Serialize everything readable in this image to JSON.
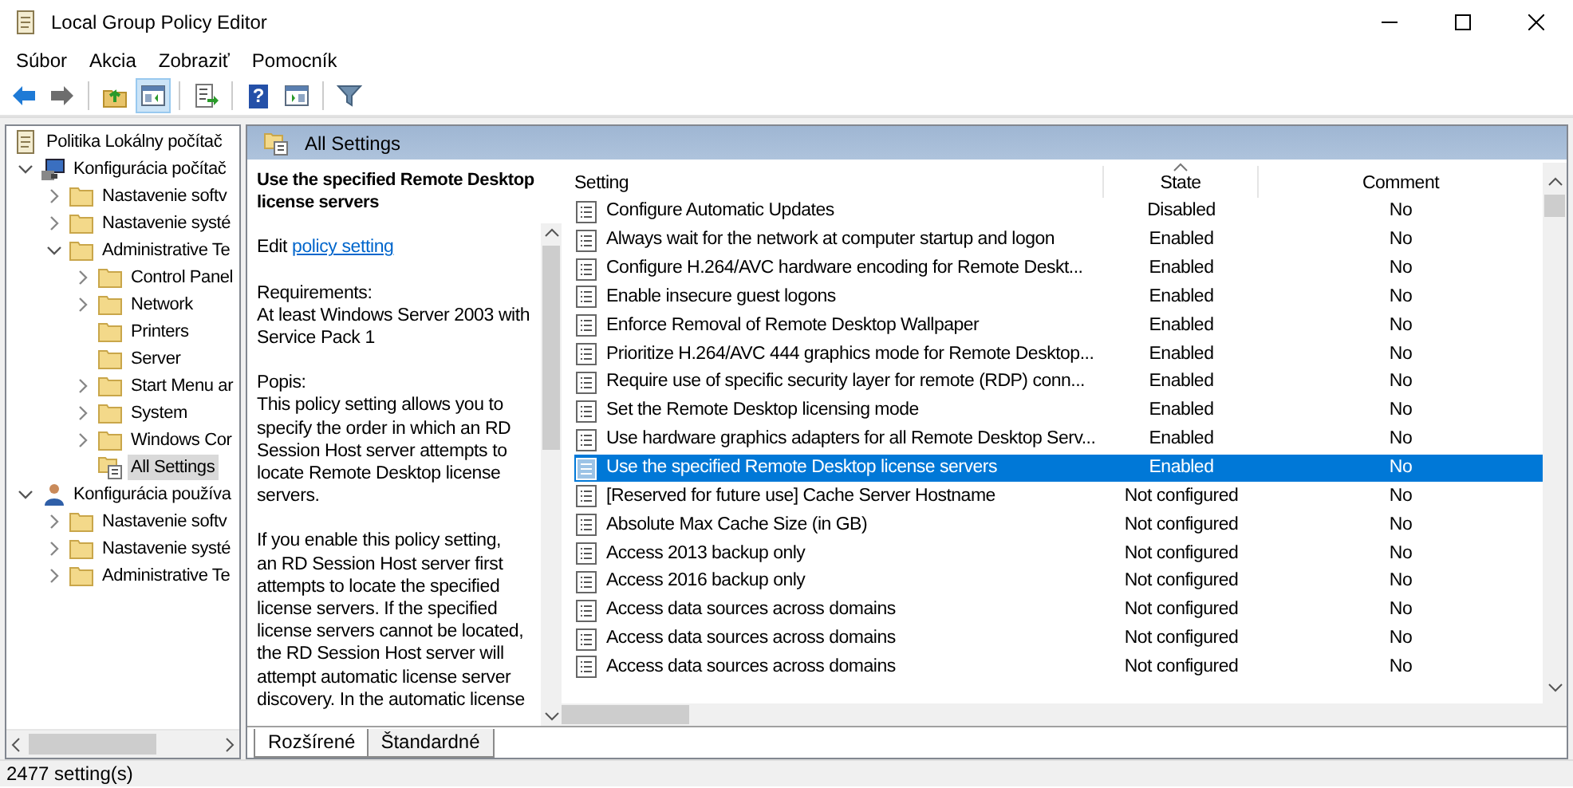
{
  "window": {
    "title": "Local Group Policy Editor"
  },
  "menu": [
    "Súbor",
    "Akcia",
    "Zobraziť",
    "Pomocník"
  ],
  "toolbar": [
    {
      "kind": "back",
      "pressed": false
    },
    {
      "kind": "forward",
      "pressed": false
    },
    {
      "kind": "up",
      "pressed": false
    },
    {
      "kind": "tree",
      "pressed": true
    },
    {
      "kind": "export",
      "pressed": false
    },
    {
      "kind": "help",
      "pressed": false,
      "glyph": "?"
    },
    {
      "kind": "pane",
      "pressed": false
    },
    {
      "kind": "filter",
      "pressed": false
    }
  ],
  "tree": [
    {
      "label": "Politika Lokálny počítač",
      "kind": "policy",
      "selected": false,
      "children": [
        {
          "label": "Konfigurácia počítač",
          "kind": "computer",
          "expanded": true,
          "selected": false,
          "children": [
            {
              "label": "Nastavenie softv",
              "kind": "folder",
              "expanded": false,
              "selected": false
            },
            {
              "label": "Nastavenie systé",
              "kind": "folder",
              "expanded": false,
              "selected": false
            },
            {
              "label": "Administrative Te",
              "kind": "folder",
              "expanded": true,
              "selected": false,
              "children": [
                {
                  "label": "Control Panel",
                  "kind": "folder",
                  "expanded": false,
                  "selected": false
                },
                {
                  "label": "Network",
                  "kind": "folder",
                  "expanded": false,
                  "selected": false
                },
                {
                  "label": "Printers",
                  "kind": "folder",
                  "selected": false
                },
                {
                  "label": "Server",
                  "kind": "folder",
                  "selected": false
                },
                {
                  "label": "Start Menu ar",
                  "kind": "folder",
                  "expanded": false,
                  "selected": false
                },
                {
                  "label": "System",
                  "kind": "folder",
                  "expanded": false,
                  "selected": false
                },
                {
                  "label": "Windows Cor",
                  "kind": "folder",
                  "expanded": false,
                  "selected": false
                },
                {
                  "label": "All Settings",
                  "kind": "settings",
                  "selected": true
                }
              ]
            }
          ]
        },
        {
          "label": "Konfigurácia používa",
          "kind": "user",
          "expanded": true,
          "selected": false,
          "children": [
            {
              "label": "Nastavenie softv",
              "kind": "folder",
              "expanded": false,
              "selected": false
            },
            {
              "label": "Nastavenie systé",
              "kind": "folder",
              "expanded": false,
              "selected": false
            },
            {
              "label": "Administrative Te",
              "kind": "folder",
              "expanded": false,
              "selected": false
            }
          ]
        }
      ]
    }
  ],
  "header": {
    "title": "All Settings"
  },
  "description": {
    "title": [
      "Use the specified Remote Desktop",
      "license servers"
    ],
    "edit_prefix": "Edit",
    "edit_link": "policy setting",
    "paragraphs": [
      [
        "Requirements:",
        "At least Windows Server 2003 with",
        "Service Pack 1"
      ],
      [
        "Popis:",
        "This policy setting allows you to",
        "specify the order in which an RD",
        "Session Host server attempts to",
        "locate Remote Desktop license",
        "servers."
      ],
      [
        "If you enable this policy setting,",
        "an RD Session Host server first",
        "attempts to locate the specified",
        "license servers. If the specified",
        "license servers cannot be located,",
        "the RD Session Host server will",
        "attempt automatic license server",
        "discovery. In the automatic license"
      ]
    ]
  },
  "table": {
    "columns": [
      {
        "label": "Setting",
        "sorted": false
      },
      {
        "label": "State",
        "sorted": true
      },
      {
        "label": "Comment",
        "sorted": false
      }
    ],
    "rows": [
      {
        "setting": "Configure Automatic Updates",
        "state": "Disabled",
        "comment": "No",
        "selected": false
      },
      {
        "setting": "Always wait for the network at computer startup and logon",
        "state": "Enabled",
        "comment": "No",
        "selected": false
      },
      {
        "setting": "Configure H.264/AVC hardware encoding for Remote Deskt...",
        "state": "Enabled",
        "comment": "No",
        "selected": false
      },
      {
        "setting": "Enable insecure guest logons",
        "state": "Enabled",
        "comment": "No",
        "selected": false
      },
      {
        "setting": "Enforce Removal of Remote Desktop Wallpaper",
        "state": "Enabled",
        "comment": "No",
        "selected": false
      },
      {
        "setting": "Prioritize H.264/AVC 444 graphics mode for Remote Desktop...",
        "state": "Enabled",
        "comment": "No",
        "selected": false
      },
      {
        "setting": "Require use of specific security layer for remote (RDP) conn...",
        "state": "Enabled",
        "comment": "No",
        "selected": false
      },
      {
        "setting": "Set the Remote Desktop licensing mode",
        "state": "Enabled",
        "comment": "No",
        "selected": false
      },
      {
        "setting": "Use hardware graphics adapters for all Remote Desktop Serv...",
        "state": "Enabled",
        "comment": "No",
        "selected": false
      },
      {
        "setting": "Use the specified Remote Desktop license servers",
        "state": "Enabled",
        "comment": "No",
        "selected": true
      },
      {
        "setting": "[Reserved for future use] Cache Server Hostname",
        "state": "Not configured",
        "comment": "No",
        "selected": false
      },
      {
        "setting": "Absolute Max Cache Size (in GB)",
        "state": "Not configured",
        "comment": "No",
        "selected": false
      },
      {
        "setting": "Access 2013 backup only",
        "state": "Not configured",
        "comment": "No",
        "selected": false
      },
      {
        "setting": "Access 2016 backup only",
        "state": "Not configured",
        "comment": "No",
        "selected": false
      },
      {
        "setting": "Access data sources across domains",
        "state": "Not configured",
        "comment": "No",
        "selected": false
      },
      {
        "setting": "Access data sources across domains",
        "state": "Not configured",
        "comment": "No",
        "selected": false
      },
      {
        "setting": "Access data sources across domains",
        "state": "Not configured",
        "comment": "No",
        "selected": false
      }
    ]
  },
  "view_tabs": [
    {
      "label": "Rozšírené",
      "selected": true
    },
    {
      "label": "Štandardné",
      "selected": false
    }
  ],
  "status_bar": "2477 setting(s)"
}
